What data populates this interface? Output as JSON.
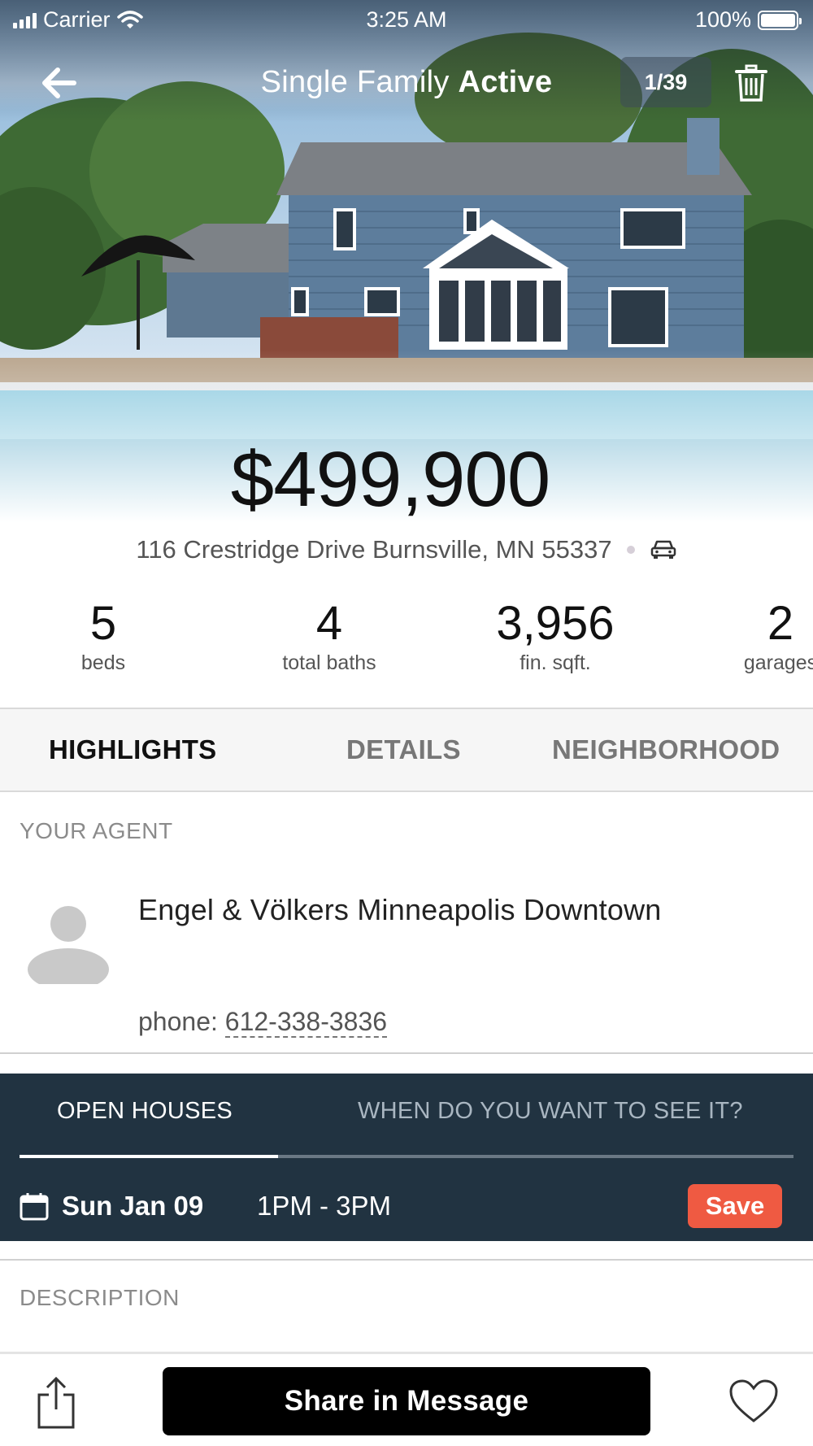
{
  "status_bar": {
    "carrier": "Carrier",
    "time": "3:25 AM",
    "battery": "100%"
  },
  "nav": {
    "title_prefix": "Single Family",
    "title_status": "Active",
    "photo_counter": "1/39",
    "back_icon": "arrow-left-icon",
    "delete_icon": "trash-icon"
  },
  "listing": {
    "price": "$499,900",
    "address": "116 Crestridge Drive Burnsville, MN 55337",
    "commute_icon": "car-icon",
    "stats": [
      {
        "value": "5",
        "label": "beds"
      },
      {
        "value": "4",
        "label": "total baths"
      },
      {
        "value": "3,956",
        "label": "fin. sqft."
      },
      {
        "value": "2",
        "label": "garages"
      }
    ]
  },
  "tabs": [
    {
      "label": "HIGHLIGHTS",
      "active": true
    },
    {
      "label": "DETAILS",
      "active": false
    },
    {
      "label": "NEIGHBORHOOD",
      "active": false
    }
  ],
  "agent": {
    "section_label": "YOUR AGENT",
    "name": "Engel & Völkers Minneapolis Downtown",
    "phone_label": "phone:",
    "phone": "612-338-3836"
  },
  "open_houses": {
    "tab_open_houses": "OPEN HOUSES",
    "tab_schedule": "WHEN DO YOU WANT TO SEE IT?",
    "date": "Sun Jan 09",
    "time": "1PM - 3PM",
    "save_label": "Save",
    "accent_color": "#ef5a42",
    "panel_color": "#213341"
  },
  "description": {
    "section_label": "DESCRIPTION"
  },
  "bottom_bar": {
    "share_icon": "share-icon",
    "share_message_label": "Share in Message",
    "favorite_icon": "heart-icon"
  }
}
